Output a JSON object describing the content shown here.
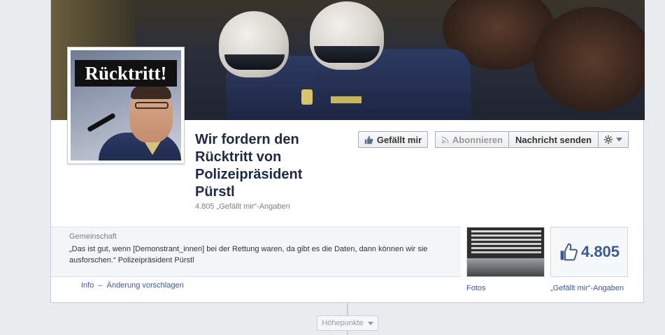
{
  "page": {
    "name": "Wir fordern den Rücktritt von Polizeipräsident Pürstl",
    "likes_line": "4.805 „Gefällt mir“-Angaben"
  },
  "profile": {
    "label": "Rücktritt!"
  },
  "actions": {
    "like": "Gefällt mir",
    "subscribe": "Abonnieren",
    "message": "Nachricht senden"
  },
  "about": {
    "category": "Gemeinschaft",
    "quote": "„Das ist gut, wenn [Demonstrant_innen] bei der Rettung waren, da gibt es die Daten, dann können wir sie ausforschen.“ Polizeipräsident Pürstl"
  },
  "links": {
    "info": "Info",
    "separator": "–",
    "suggest": "Änderung vorschlagen"
  },
  "apps": {
    "photos_label": "Fotos",
    "likes_count": "4.805",
    "likes_label": "„Gefällt mir“-Angaben"
  },
  "timeline": {
    "highlights": "Höhepunkte"
  },
  "colors": {
    "link": "#3b5998",
    "title": "#1c2a47",
    "background": "#e9ebee"
  }
}
